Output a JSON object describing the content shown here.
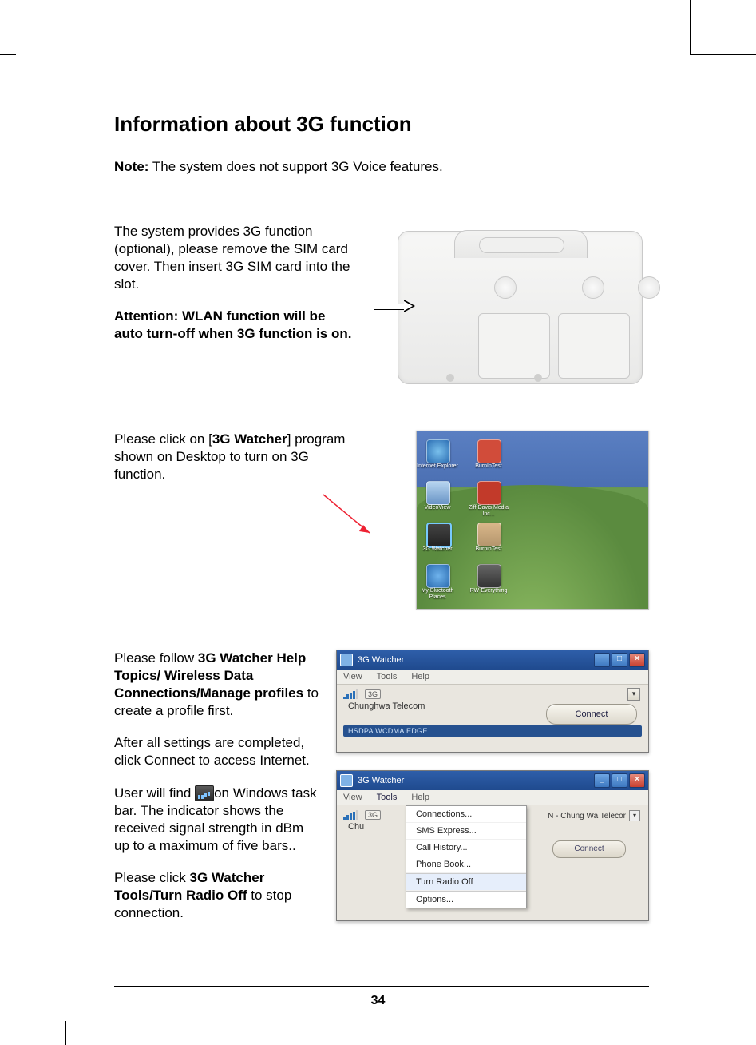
{
  "heading": "Information about 3G function",
  "note_label": "Note:",
  "note_text": " The system does not support 3G Voice features.",
  "section1": {
    "p1": "The system provides 3G function (optional), please remove the SIM card cover. Then insert 3G SIM card into the slot.",
    "p2": "Attention: WLAN function will be auto turn-off when 3G function is on."
  },
  "section2": {
    "pre": "Please click on [",
    "bold": "3G Watcher",
    "post": "] program shown on Desktop to turn on 3G function."
  },
  "desktop_icons": {
    "ie": "Internet Explorer",
    "bn": "BurnInTest",
    "vv": "VideoView",
    "zd": "Ziff Davis Media Inc...",
    "gw": "3G Watcher",
    "bt": "BurninTest",
    "mb": "My Bluetooth Places",
    "rw": "RW-Everything"
  },
  "section3": {
    "p1_pre": "Please follow ",
    "p1_bold": "3G Watcher Help Topics/ Wireless Data Connections/Manage profiles",
    "p1_post": " to create a profile first.",
    "p2": "After all settings are completed, click Connect to access Internet.",
    "p3_pre": "User will find ",
    "p3_post": "on Windows task bar. The indicator shows the received signal strength in dBm up to a maximum of five bars..",
    "p4_pre": "Please click ",
    "p4_bold": "3G Watcher Tools/Turn Radio Off",
    "p4_post": " to stop connection."
  },
  "watcher1": {
    "title": "3G Watcher",
    "menu": {
      "view": "View",
      "tools": "Tools",
      "help": "Help"
    },
    "mode": "3G",
    "carrier": "Chunghwa Telecom",
    "connect": "Connect",
    "status": "HSDPA WCDMA EDGE"
  },
  "watcher2": {
    "title": "3G Watcher",
    "menu": {
      "view": "View",
      "tools": "Tools",
      "help": "Help"
    },
    "carrier_prefix": "Chu",
    "carrier_sel": "N - Chung Wa Telecor",
    "connect": "Connect",
    "popup": {
      "connections": "Connections...",
      "sms": "SMS Express...",
      "call": "Call History...",
      "phone": "Phone Book...",
      "radio": "Turn Radio Off",
      "options": "Options..."
    }
  },
  "page_number": "34"
}
